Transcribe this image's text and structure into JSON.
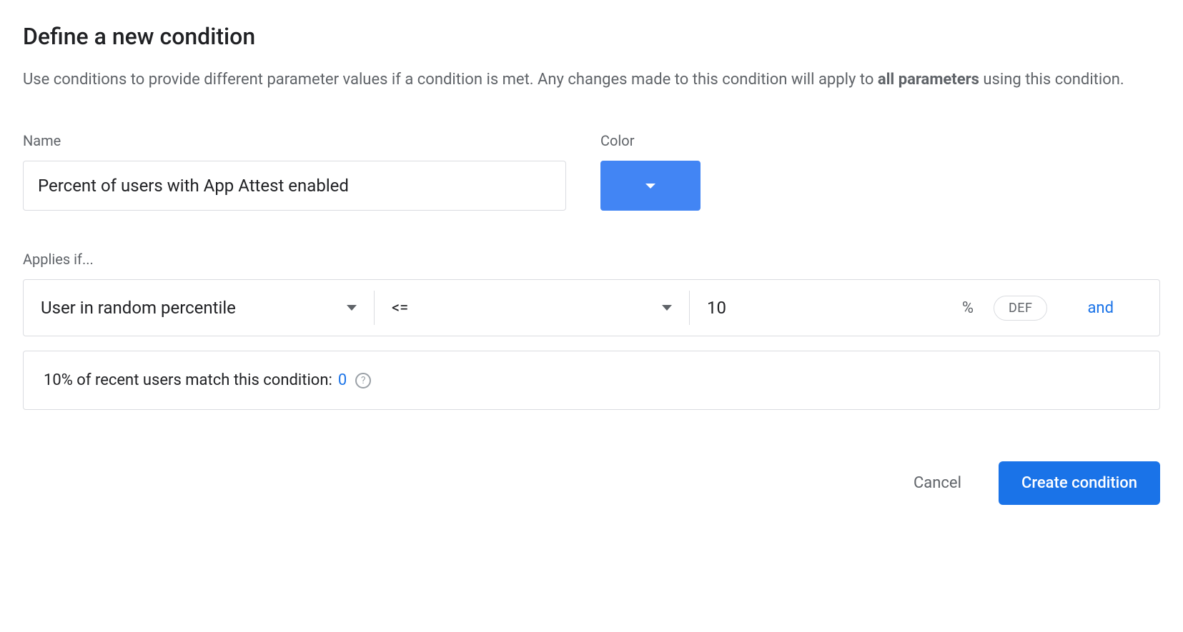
{
  "title": "Define a new condition",
  "description": {
    "prefix": "Use conditions to provide different parameter values if a condition is met. Any changes made to this condition will apply to ",
    "bold": "all parameters",
    "suffix": " using this condition."
  },
  "form": {
    "name_label": "Name",
    "name_value": "Percent of users with App Attest enabled",
    "color_label": "Color",
    "color_value": "#4285f4"
  },
  "applies_if": {
    "label": "Applies if...",
    "condition_type": "User in random percentile",
    "operator": "<=",
    "value": "10",
    "unit": "%",
    "seed_label": "DEF",
    "and_label": "and"
  },
  "match_info": {
    "text": "10% of recent users match this condition: ",
    "count": "0"
  },
  "footer": {
    "cancel": "Cancel",
    "create": "Create condition"
  }
}
